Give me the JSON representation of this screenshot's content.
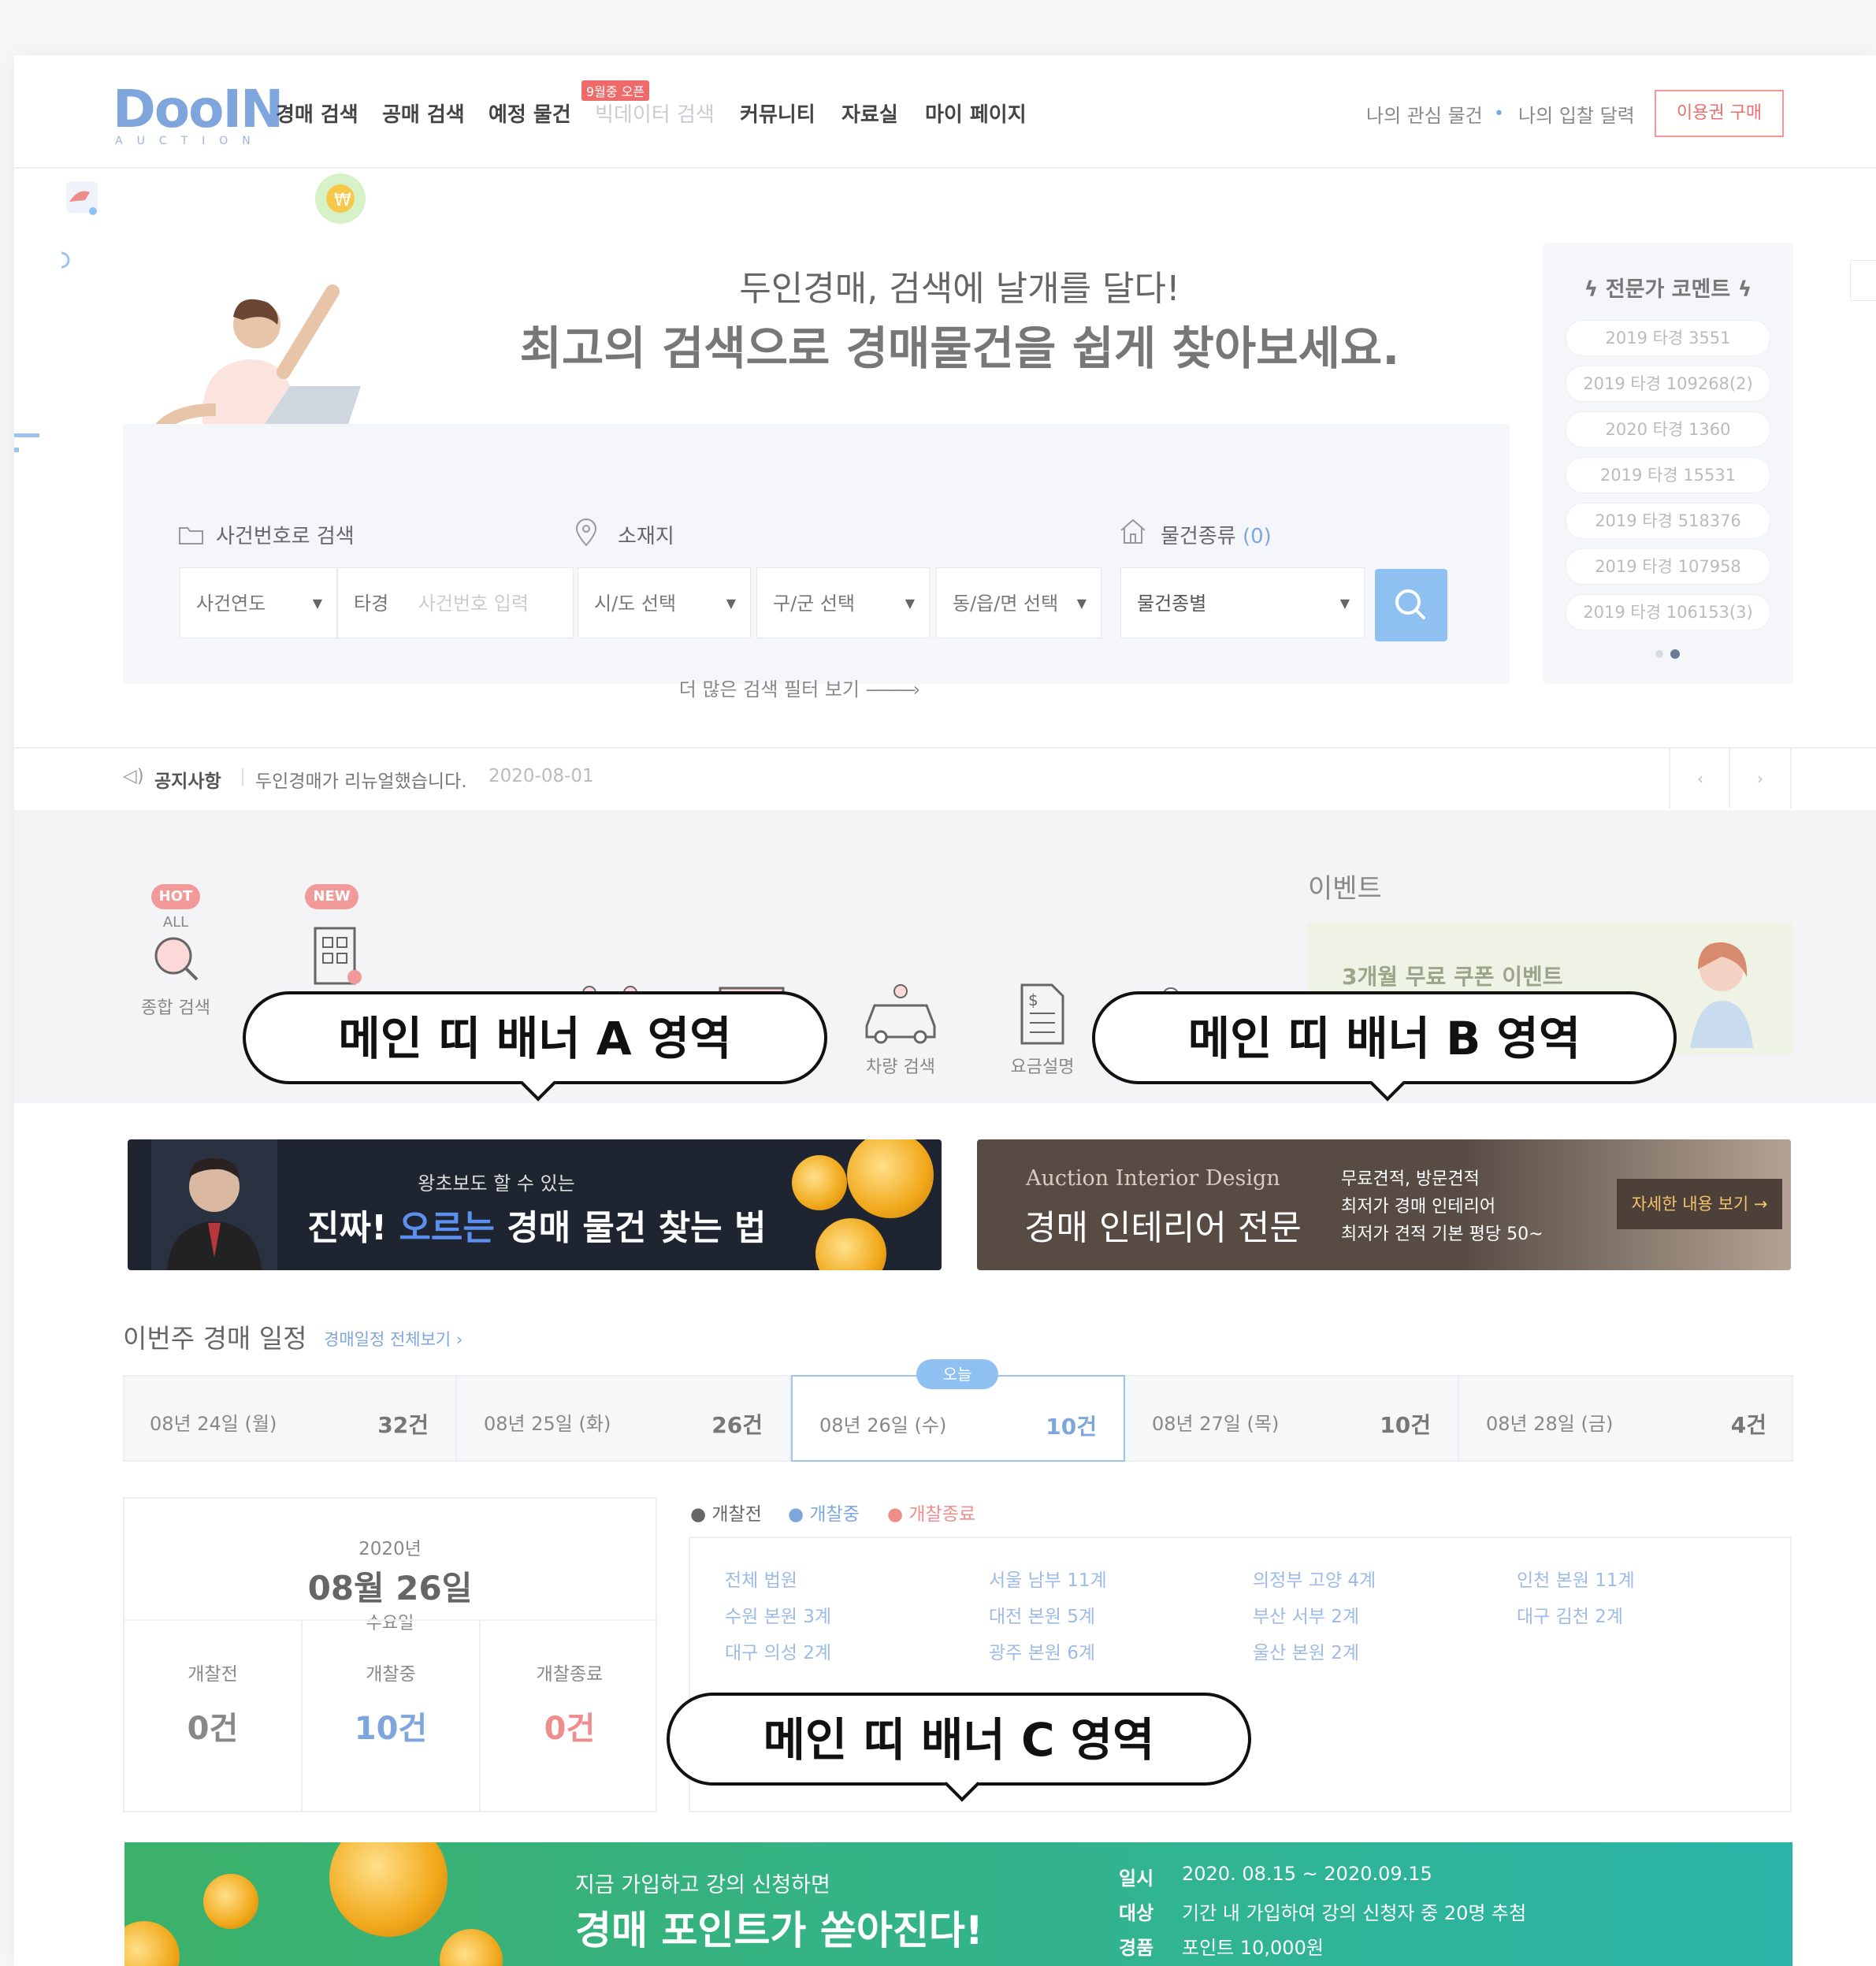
{
  "header": {
    "logo": "DooIN",
    "logo_sub": "AUCTION",
    "nav": [
      "경매 검색",
      "공매 검색",
      "예정 물건",
      "빅데이터 검색",
      "커뮤니티",
      "자료실",
      "마이 페이지"
    ],
    "nav_badge": "9월중 오픈",
    "right_links": [
      "나의 관심 물건",
      "나의 입찰 달력"
    ],
    "buy_button": "이용권 구매"
  },
  "hero": {
    "title_line1": "두인경매, 검색에 날개를 달다!",
    "title_line2": "최고의 검색으로 경매물건을 쉽게 찾아보세요."
  },
  "search": {
    "case_label": "사건번호로 검색",
    "location_label": "소재지",
    "type_label": "물건종류",
    "type_count": "(0)",
    "case_year": "사건연도",
    "case_prefix": "타경",
    "case_placeholder": "사건번호 입력",
    "sido": "시/도 선택",
    "gugun": "구/군 선택",
    "dong": "동/읍/면 선택",
    "item_type": "물건종별",
    "more_filters": "더 많은 검색 필터 보기"
  },
  "expert": {
    "title": "전문가 코멘트",
    "items": [
      "2019 타경 3551",
      "2019 타경 109268(2)",
      "2020 타경 1360",
      "2019 타경 15531",
      "2019 타경 518376",
      "2019 타경 107958",
      "2019 타경 106153(3)"
    ]
  },
  "notice": {
    "label": "공지사항",
    "text": "두인경매가 리뉴얼했습니다.",
    "date": "2020-08-01"
  },
  "categories": {
    "items": [
      {
        "label": "종합 검색",
        "tag": "HOT",
        "sub": "ALL"
      },
      {
        "label": "",
        "tag": "NEW",
        "sub": ""
      },
      {
        "label": "",
        "tag": "",
        "sub": ""
      },
      {
        "label": "",
        "tag": "",
        "sub": ""
      },
      {
        "label": "",
        "tag": "",
        "sub": ""
      },
      {
        "label": "차량 검색",
        "tag": "",
        "sub": ""
      },
      {
        "label": "요금설명",
        "tag": "",
        "sub": ""
      },
      {
        "label": "",
        "tag": "",
        "sub": ""
      }
    ]
  },
  "event": {
    "title": "이벤트",
    "banner_text": "3개월 무료 쿠폰 이벤트"
  },
  "callouts": {
    "a": "메인 띠 배너 A 영역",
    "b": "메인 띠 배너 B 영역",
    "c": "메인 띠 배너 C 영역"
  },
  "ad_a": {
    "line1": "왕초보도 할 수 있는",
    "line2_a": "진짜!",
    "line2_b": "오르는",
    "line2_c": "경매 물건 찾는 법"
  },
  "ad_b": {
    "eng": "Auction Interior Design",
    "title": "경매 인테리어 전문",
    "points": [
      "무료견적, 방문견적",
      "최저가 경매 인테리어",
      "최저가 견적 기본 평당 50~"
    ],
    "cta": "자세한 내용 보기 →"
  },
  "schedule": {
    "title": "이번주 경매 일정",
    "link": "경매일정 전체보기 ›",
    "today_badge": "오늘",
    "days": [
      {
        "date": "08년 24일 (월)",
        "count": "32건"
      },
      {
        "date": "08년 25일 (화)",
        "count": "26건"
      },
      {
        "date": "08년 26일 (수)",
        "count": "10건"
      },
      {
        "date": "08년 27일 (목)",
        "count": "10건"
      },
      {
        "date": "08년 28일 (금)",
        "count": "4건"
      }
    ],
    "year": "2020년",
    "date": "08월 26일",
    "weekday": "수요일",
    "stats": [
      {
        "label": "개찰전",
        "value": "0건"
      },
      {
        "label": "개찰중",
        "value": "10건"
      },
      {
        "label": "개찰종료",
        "value": "0건"
      }
    ],
    "legend": [
      "개찰전",
      "개찰중",
      "개찰종료"
    ],
    "courts": [
      "전체 법원",
      "서울 남부 11계",
      "의정부 고양 4계",
      "인천 본원 11계",
      "수원 본원 3계",
      "대전 본원 5계",
      "부산 서부 2계",
      "대구 김천 2계",
      "대구 의성 2계",
      "광주 본원 6계",
      "울산 본원 2계"
    ]
  },
  "ad_c": {
    "line1": "지금 가입하고 강의 신청하면",
    "line2": "경매 포인트가 쏟아진다!",
    "info": [
      {
        "k": "일시",
        "v": "2020. 08.15 ~ 2020.09.15"
      },
      {
        "k": "대상",
        "v": "기간 내 가입하여 강의 신청자 중 20명 추첨"
      },
      {
        "k": "경품",
        "v": "포인트 10,000원"
      }
    ]
  },
  "colors": {
    "accent": "#7ea6dd",
    "pink": "#ef8d8d",
    "dark": "#111111"
  }
}
